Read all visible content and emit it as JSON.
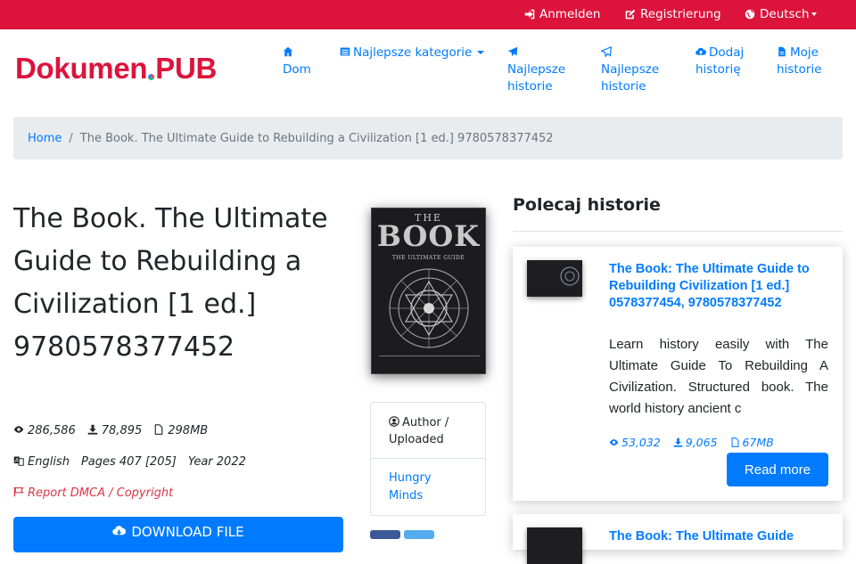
{
  "topbar": {
    "login": "Anmelden",
    "register": "Registrierung",
    "language": "Deutsch"
  },
  "header": {
    "logo": {
      "part1": "Dokumen",
      "part2": "PUB"
    },
    "nav": [
      {
        "label": "Dom",
        "icon": "home-icon"
      },
      {
        "label": "Najlepsze kategorie",
        "icon": "list-icon"
      },
      {
        "label": "Najlepsze historie",
        "icon": "paper-plane-icon"
      },
      {
        "label": "Najlepsze historie",
        "icon": "paper-plane-outline-icon"
      },
      {
        "label": "Dodaj historię",
        "icon": "cloud-upload-icon"
      },
      {
        "label": "Moje historie",
        "icon": "file-icon"
      }
    ]
  },
  "breadcrumb": {
    "home": "Home",
    "separator": "/",
    "current": "The Book. The Ultimate Guide to Rebuilding a Civilization [1 ed.] 9780578377452"
  },
  "book": {
    "title": "The Book. The Ultimate Guide to Rebuilding a Civilization [1 ed.] 9780578377452",
    "views": "286,586",
    "downloads": "78,895",
    "size": "298MB",
    "language": "English",
    "pages": "Pages 407 [205]",
    "year": "Year 2022",
    "report": "Report DMCA / Copyright",
    "download_label": "DOWNLOAD FILE",
    "cover": {
      "line1": "THE",
      "line2": "BOOK",
      "line3": "THE ULTIMATE GUIDE"
    }
  },
  "author_box": {
    "heading": "Author / Uploaded",
    "author": "Hungry Minds"
  },
  "recommended": {
    "heading": "Polecaj historie",
    "cards": [
      {
        "title": "The Book: The Ultimate Guide to Rebuilding Civilization [1 ed.] 0578377454, 9780578377452",
        "description": "Learn history easily with The Ultimate Guide To Rebuilding A Civilization. Structured book. The world history ancient c",
        "views": "53,032",
        "downloads": "9,065",
        "size": "67MB",
        "read_more": "Read more"
      },
      {
        "title": "The Book: The Ultimate Guide"
      }
    ]
  },
  "colors": {
    "brand_red": "#dc143c",
    "link_blue": "#007bff",
    "breadcrumb_bg": "#e9ecef"
  }
}
